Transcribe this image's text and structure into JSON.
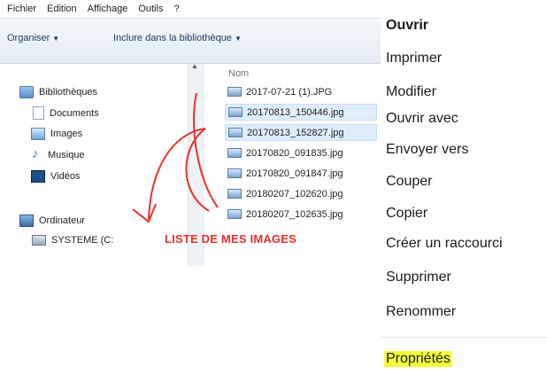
{
  "menubar": {
    "items": [
      "Fichier",
      "Edition",
      "Affichage",
      "Outils",
      "?"
    ]
  },
  "toolbar": {
    "organise": "Organiser",
    "include": "Inclure dans la bibliothèque"
  },
  "navpane": {
    "items": [
      {
        "label": "Bibliothèques",
        "icon": "library-icon"
      },
      {
        "label": "Documents",
        "icon": "documents-icon"
      },
      {
        "label": "Images",
        "icon": "images-icon"
      },
      {
        "label": "Musique",
        "icon": "music-icon"
      },
      {
        "label": "Vidéos",
        "icon": "videos-icon"
      },
      {
        "label": "Ordinateur",
        "icon": "computer-icon"
      },
      {
        "label": "SYSTEME (C:",
        "icon": "drive-icon"
      }
    ]
  },
  "filepane": {
    "column_header": "Nom",
    "files": [
      "2017-07-21 (1).JPG",
      "20170813_150446.jpg",
      "20170813_152827.jpg",
      "20170820_091835.jpg",
      "20170820_091847.jpg",
      "20180207_102620.jpg",
      "20180207_102635.jpg"
    ]
  },
  "annotation": {
    "text": "LISTE DE MES IMAGES",
    "color": "#e8302a"
  },
  "context_menu": {
    "items": [
      "Ouvrir",
      "Imprimer",
      "Modifier",
      "Ouvrir avec",
      "Envoyer vers",
      "Couper",
      "Copier",
      "Créer un raccourci",
      "Supprimer",
      "Renommer",
      "Propriétés"
    ],
    "highlight_color": "#f5ff3a"
  }
}
